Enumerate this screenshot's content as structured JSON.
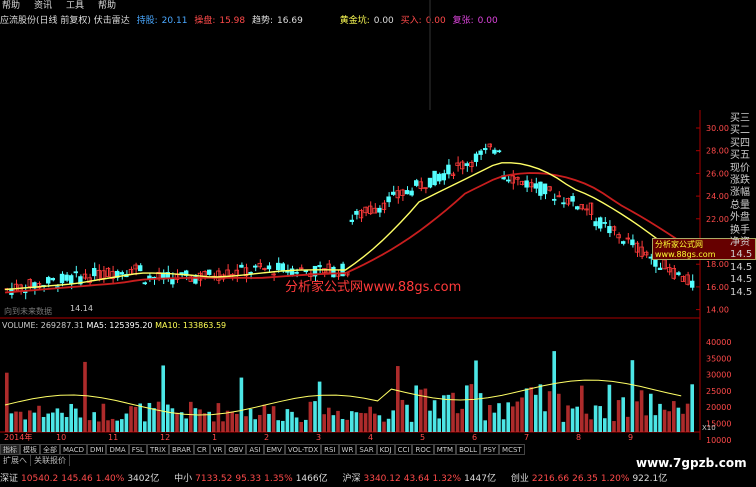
{
  "menu": [
    "帮助",
    "资讯",
    "工具",
    "帮助"
  ],
  "info": {
    "title": "应流股份(日线 前复权) 伏击雷达",
    "l1_label": "持股:",
    "l1_value": "20.11",
    "l2_label": "操盘:",
    "l2_value": "15.98",
    "l3_label": "趋势:",
    "l3_value": "16.69",
    "l4_label": "黄金坑:",
    "l4_value": "0.00",
    "l5_label": "买入:",
    "l5_value": "0.00",
    "l6_label": "复张:",
    "l6_value": "0.00",
    "colors": {
      "l1": "#4aa8ff",
      "l2": "#ff4a4a",
      "l3": "#dddddd",
      "l4": "#ffff55",
      "l5": "#ff4a4a",
      "l6": "#dd44dd"
    }
  },
  "volume": {
    "label": "VOLUME: 269287.31",
    "ma5": "MA5: 125395.20",
    "ma10": "MA10: 133863.59"
  },
  "chart_data": {
    "type": "candlestick",
    "price_ticks": [
      "30.00",
      "28.00",
      "26.00",
      "24.00",
      "22.00",
      "20.00",
      "18.00",
      "16.00",
      "14.00"
    ],
    "volume_ticks": [
      "40000",
      "35000",
      "30000",
      "25000",
      "20000",
      "15000",
      "10000"
    ],
    "low_marker": "14.14",
    "date_labels": [
      "2014年",
      "10",
      "11",
      "12",
      "1",
      "2",
      "3",
      "4",
      "5",
      "6",
      "7",
      "8",
      "9"
    ],
    "x10": "X10"
  },
  "side_panel": [
    "买三",
    "买二",
    "买四",
    "买五",
    "现价",
    "涨跌",
    "涨幅",
    "总量",
    "外盘",
    "换手",
    "净资"
  ],
  "side_prices": [
    "14.5",
    "14.5",
    "14.5",
    "14.5"
  ],
  "watermark": "分析家公式网www.88gs.com",
  "watermark_small": "分析家公式网www.88gs.com",
  "hint_text": "向到未来数据",
  "tabs": [
    "指标",
    "模板",
    "全部"
  ],
  "indicators": [
    "MACD",
    "DMI",
    "DMA",
    "FSL",
    "TRIX",
    "BRAR",
    "CR",
    "VR",
    "OBV",
    "ASI",
    "EMV",
    "VOL-TDX",
    "RSI",
    "WR",
    "SAR",
    "KDJ",
    "CCI",
    "ROC",
    "MTM",
    "BOLL",
    "PSY",
    "MCST"
  ],
  "ext_tabs": [
    "扩展へ",
    "关联报价"
  ],
  "bottom": {
    "i1_name": "深证",
    "i1_val": "10540.2",
    "i1_chg": "145.46",
    "i1_pct": "1.40%",
    "i1_amt": "3402亿",
    "i2_name": "中小",
    "i2_val": "7133.52",
    "i2_chg": "95.33",
    "i2_pct": "1.35%",
    "i2_amt": "1466亿",
    "i3_name": "沪深",
    "i3_val": "3340.12",
    "i3_chg": "43.64",
    "i3_pct": "1.32%",
    "i3_amt": "1447亿",
    "i4_name": "创业",
    "i4_val": "2216.66",
    "i4_chg": "26.35",
    "i4_pct": "1.20%",
    "i4_amt": "922.1亿"
  },
  "site": "www.7gpzb.com"
}
